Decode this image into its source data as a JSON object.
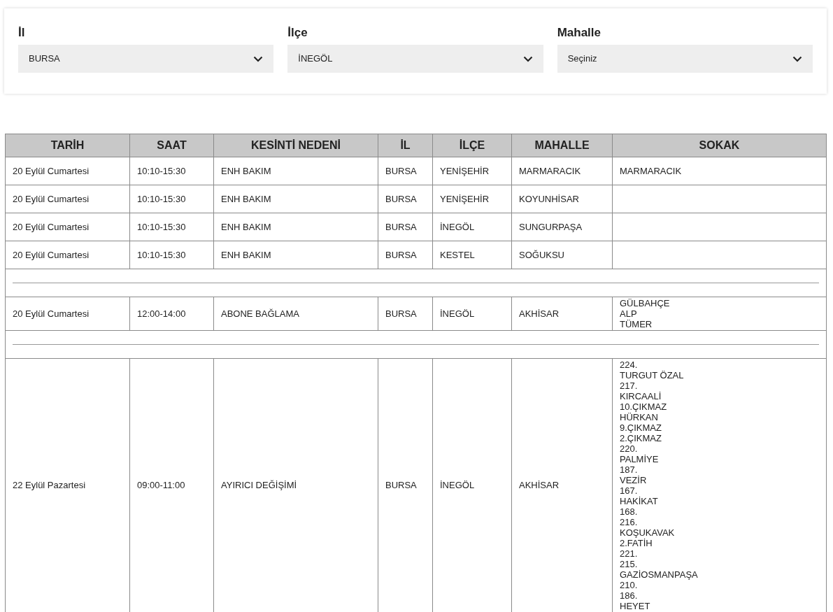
{
  "filters": [
    {
      "label": "İl",
      "value": "BURSA"
    },
    {
      "label": "İlçe",
      "value": "İNEGÖL"
    },
    {
      "label": "Mahalle",
      "value": "Seçiniz"
    }
  ],
  "table": {
    "columns": [
      "TARİH",
      "SAAT",
      "KESİNTİ NEDENİ",
      "İL",
      "İLÇE",
      "MAHALLE",
      "SOKAK"
    ],
    "rows": [
      {
        "kind": "data",
        "cells": [
          "20 Eylül Cumartesi",
          "10:10-15:30",
          "ENH BAKIM",
          "BURSA",
          "YENİŞEHİR",
          "MARMARACIK"
        ],
        "sokak": [
          "MARMARACIK"
        ]
      },
      {
        "kind": "data",
        "cells": [
          "20 Eylül Cumartesi",
          "10:10-15:30",
          "ENH BAKIM",
          "BURSA",
          "YENİŞEHİR",
          "KOYUNHİSAR"
        ]
      },
      {
        "kind": "data",
        "cells": [
          "20 Eylül Cumartesi",
          "10:10-15:30",
          "ENH BAKIM",
          "BURSA",
          "İNEGÖL",
          "SUNGURPAŞA"
        ]
      },
      {
        "kind": "data",
        "cells": [
          "20 Eylül Cumartesi",
          "10:10-15:30",
          "ENH BAKIM",
          "BURSA",
          "KESTEL",
          "SOĞUKSU"
        ]
      },
      {
        "kind": "separator"
      },
      {
        "kind": "data",
        "cells": [
          "20 Eylül Cumartesi",
          "12:00-14:00",
          "ABONE BAĞLAMA",
          "BURSA",
          "İNEGÖL",
          "AKHİSAR"
        ],
        "sokak": [
          "GÜLBAHÇE",
          "ALP",
          "TÜMER"
        ]
      },
      {
        "kind": "separator"
      },
      {
        "kind": "data",
        "cells": [
          "22 Eylül Pazartesi",
          "09:00-11:00",
          "AYIRICI DEĞİŞİMİ",
          "BURSA",
          "İNEGÖL",
          "AKHİSAR"
        ],
        "sokak": [
          "224.",
          "TURGUT ÖZAL",
          "217.",
          "KIRCAALİ",
          "10.ÇIKMAZ",
          "HÜRKAN",
          "9.ÇIKMAZ",
          "2.ÇIKMAZ",
          "220.",
          "PALMİYE",
          "187.",
          "VEZİR",
          "167.",
          "HAKİKAT",
          "168.",
          "216.",
          "KOŞUKAVAK",
          "2.FATİH",
          "221.",
          "215.",
          "GAZİOSMANPAŞA",
          "210.",
          "186.",
          "HEYET"
        ]
      }
    ]
  }
}
